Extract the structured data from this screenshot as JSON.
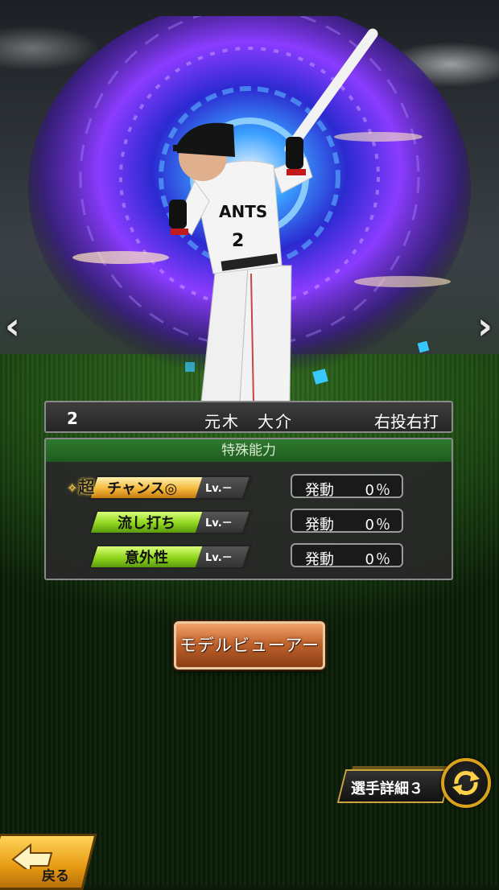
{
  "nav": {
    "prev_icon": "chevron-left-icon",
    "next_icon": "chevron-right-icon"
  },
  "player": {
    "number": "2",
    "name": "元木　大介",
    "handedness": "右投右打",
    "jersey_text": "ANTS",
    "jersey_number": "2"
  },
  "abilities": {
    "header": "特殊能力",
    "items": [
      {
        "prefix": "超",
        "name": "チャンス◎",
        "level": "Lv.－",
        "activate_label": "発動",
        "rate": "0％",
        "tier": "gold"
      },
      {
        "prefix": "",
        "name": "流し打ち",
        "level": "Lv.－",
        "activate_label": "発動",
        "rate": "0％",
        "tier": "green"
      },
      {
        "prefix": "",
        "name": "意外性",
        "level": "Lv.－",
        "activate_label": "発動",
        "rate": "0％",
        "tier": "green"
      }
    ]
  },
  "buttons": {
    "model_viewer": "モデルビューアー",
    "detail": "選手詳細３",
    "detail_icon": "cycle-arrows-icon",
    "back": "戻る",
    "back_icon": "back-arrow-icon"
  },
  "colors": {
    "gold_badge": "#f4b83a",
    "green_badge": "#8fd41c",
    "header_green": "#2f7a2f",
    "button_brown": "#c2642e",
    "back_yellow": "#e79a12",
    "portal_purple": "#8a3cff",
    "portal_blue": "#3aa0ff"
  }
}
